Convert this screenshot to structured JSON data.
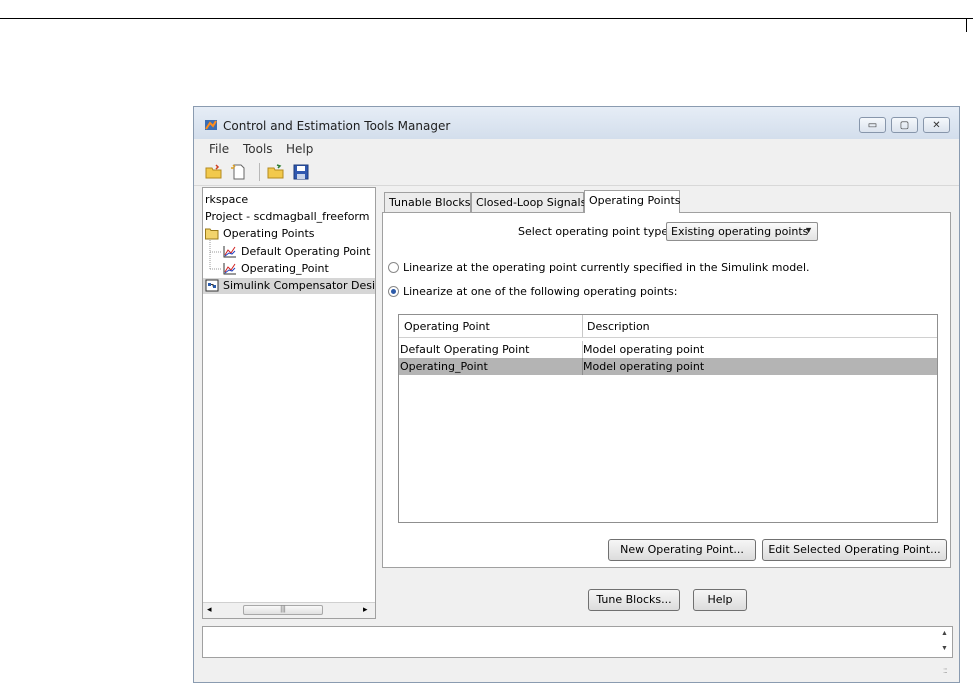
{
  "window": {
    "title": "Control and Estimation Tools Manager",
    "controls": {
      "minimize": "▭",
      "maximize": "▢",
      "close": "✕"
    }
  },
  "menu": {
    "items": [
      "File",
      "Tools",
      "Help"
    ]
  },
  "toolbar": {
    "icons": [
      "open-project-icon",
      "new-document-icon",
      "open-folder-icon",
      "save-icon"
    ]
  },
  "tree": {
    "items": [
      {
        "label": "rkspace",
        "icon": ""
      },
      {
        "label": "Project - scdmagball_freeform",
        "icon": ""
      },
      {
        "label": "Operating Points",
        "icon": "folder-icon"
      },
      {
        "label": "Default Operating Point",
        "icon": "plot-icon"
      },
      {
        "label": "Operating_Point",
        "icon": "plot-icon"
      },
      {
        "label": "Simulink Compensator Design",
        "icon": "simulink-icon"
      }
    ],
    "scroll_left": "◂",
    "scroll_right": "▸",
    "scroll_grip": "|||"
  },
  "tabs": [
    "Tunable Blocks",
    "Closed-Loop Signals",
    "Operating Points"
  ],
  "operating_points": {
    "select_label": "Select operating point type:",
    "select_value": "Existing operating points",
    "select_arrow": "▼",
    "radio_current": "Linearize at the operating point currently specified in the Simulink model.",
    "radio_list": "Linearize at one of the following operating points:",
    "table": {
      "headers": [
        "Operating Point",
        "Description"
      ],
      "rows": [
        [
          "Default Operating Point",
          "Model operating point"
        ],
        [
          "Operating_Point",
          "Model operating point"
        ]
      ]
    },
    "new_button": "New Operating Point...",
    "edit_button": "Edit Selected Operating Point..."
  },
  "footer_buttons": {
    "tune": "Tune Blocks...",
    "help": "Help"
  },
  "bottom_pane": {
    "scroll_up": "▲",
    "scroll_down": "▼",
    "grip": ":::"
  },
  "colors": {
    "selection": "#b4b4b4",
    "title_gradient_top": "#e6edf6"
  }
}
